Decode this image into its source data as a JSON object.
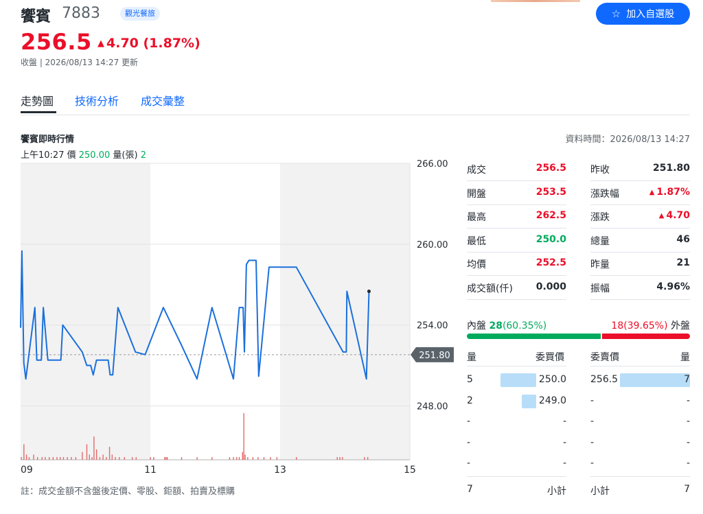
{
  "header": {
    "stock_name": "饗賓",
    "stock_code": "7883",
    "sector_tag": "觀光餐旅",
    "watch_button": "加入自選股",
    "watch_icon": "star-icon",
    "price": "256.5",
    "change": "4.70 (1.87%)",
    "close_time": "收盤 | 2026/08/13 14:27 更新"
  },
  "tabs": [
    {
      "label": "走勢圖",
      "active": true
    },
    {
      "label": "技術分析",
      "active": false
    },
    {
      "label": "成交彙整",
      "active": false
    }
  ],
  "section": {
    "title": "饗賓即時行情",
    "data_time": "資料時間：2026/08/13 14:27",
    "hover_time": "上午10:27",
    "hover_price_label": "價",
    "hover_price": "250.00",
    "hover_vol_label": "量(張)",
    "hover_vol": "2"
  },
  "chart_data": {
    "type": "line",
    "y_ticks": [
      "266.00",
      "260.00",
      "254.00",
      "248.00"
    ],
    "ylim": [
      244.0,
      266.0
    ],
    "x_ticks": [
      "09",
      "11",
      "13",
      "15"
    ],
    "reference_price": "251.80",
    "prev_close_value": 251.8,
    "price_series": [
      [
        9.0,
        253.8
      ],
      [
        9.02,
        259.5
      ],
      [
        9.05,
        251.2
      ],
      [
        9.08,
        250.0
      ],
      [
        9.22,
        255.3
      ],
      [
        9.25,
        251.4
      ],
      [
        9.32,
        251.4
      ],
      [
        9.35,
        255.3
      ],
      [
        9.42,
        251.4
      ],
      [
        9.62,
        251.4
      ],
      [
        9.65,
        254.0
      ],
      [
        9.95,
        252.0
      ],
      [
        10.02,
        251.0
      ],
      [
        10.08,
        251.0
      ],
      [
        10.12,
        250.3
      ],
      [
        10.17,
        251.4
      ],
      [
        10.35,
        251.4
      ],
      [
        10.38,
        250.3
      ],
      [
        10.42,
        250.3
      ],
      [
        10.5,
        255.3
      ],
      [
        10.77,
        252.0
      ],
      [
        10.92,
        251.8
      ],
      [
        11.2,
        255.3
      ],
      [
        11.48,
        252.5
      ],
      [
        11.72,
        250.0
      ],
      [
        11.95,
        255.3
      ],
      [
        12.28,
        250.0
      ],
      [
        12.37,
        255.3
      ],
      [
        12.43,
        255.3
      ],
      [
        12.45,
        252.0
      ],
      [
        12.48,
        258.5
      ],
      [
        12.52,
        258.8
      ],
      [
        12.63,
        258.8
      ],
      [
        12.67,
        250.2
      ],
      [
        12.83,
        258.3
      ],
      [
        13.25,
        258.3
      ],
      [
        13.97,
        252.0
      ],
      [
        14.02,
        252.0
      ],
      [
        14.03,
        256.5
      ],
      [
        14.33,
        250.0
      ],
      [
        14.37,
        256.5
      ]
    ],
    "last_price": 256.5,
    "volume_series": [
      [
        9.01,
        1
      ],
      [
        9.05,
        6
      ],
      [
        9.09,
        2
      ],
      [
        9.13,
        1
      ],
      [
        9.2,
        2
      ],
      [
        9.26,
        1
      ],
      [
        9.33,
        1
      ],
      [
        9.38,
        1
      ],
      [
        9.44,
        1
      ],
      [
        9.5,
        1
      ],
      [
        9.56,
        1
      ],
      [
        9.61,
        1
      ],
      [
        9.66,
        1
      ],
      [
        9.72,
        1
      ],
      [
        9.78,
        1
      ],
      [
        9.85,
        1
      ],
      [
        9.95,
        3
      ],
      [
        10.02,
        6
      ],
      [
        10.06,
        2
      ],
      [
        10.1,
        1
      ],
      [
        10.13,
        9
      ],
      [
        10.17,
        4
      ],
      [
        10.22,
        1
      ],
      [
        10.27,
        2
      ],
      [
        10.32,
        1
      ],
      [
        10.37,
        5
      ],
      [
        10.41,
        2
      ],
      [
        10.46,
        1
      ],
      [
        10.52,
        1
      ],
      [
        10.6,
        1
      ],
      [
        10.72,
        1
      ],
      [
        10.78,
        1
      ],
      [
        11.0,
        1
      ],
      [
        11.05,
        1
      ],
      [
        11.22,
        1
      ],
      [
        11.24,
        1
      ],
      [
        11.26,
        1
      ],
      [
        11.48,
        1
      ],
      [
        11.72,
        1
      ],
      [
        11.95,
        1
      ],
      [
        12.22,
        1
      ],
      [
        12.28,
        1
      ],
      [
        12.33,
        1
      ],
      [
        12.37,
        1
      ],
      [
        12.42,
        3
      ],
      [
        12.44,
        18
      ],
      [
        12.46,
        2
      ],
      [
        12.5,
        1
      ],
      [
        12.58,
        1
      ],
      [
        12.66,
        1
      ],
      [
        12.75,
        1
      ],
      [
        12.85,
        1
      ],
      [
        12.95,
        1
      ],
      [
        13.25,
        1
      ],
      [
        13.88,
        1
      ],
      [
        13.92,
        1
      ],
      [
        13.96,
        1
      ],
      [
        14.3,
        1
      ],
      [
        14.35,
        1
      ]
    ],
    "volume_max": 18,
    "grid": true,
    "shaded_hours": [
      [
        9,
        11
      ],
      [
        13,
        15
      ]
    ]
  },
  "stats": {
    "left": [
      {
        "label": "成交",
        "value": "256.5",
        "color": "red"
      },
      {
        "label": "開盤",
        "value": "253.5",
        "color": "red"
      },
      {
        "label": "最高",
        "value": "262.5",
        "color": "red"
      },
      {
        "label": "最低",
        "value": "250.0",
        "color": "green"
      },
      {
        "label": "均價",
        "value": "252.5",
        "color": "red"
      },
      {
        "label": "成交額(仟)",
        "value": "0.000",
        "color": "dark"
      }
    ],
    "right": [
      {
        "label": "昨收",
        "value": "251.80",
        "color": "dark"
      },
      {
        "label": "漲跌幅",
        "value": "1.87%",
        "color": "red",
        "arrow": true
      },
      {
        "label": "漲跌",
        "value": "4.70",
        "color": "red",
        "arrow": true
      },
      {
        "label": "總量",
        "value": "46",
        "color": "dark"
      },
      {
        "label": "昨量",
        "value": "21",
        "color": "dark"
      },
      {
        "label": "振幅",
        "value": "4.96%",
        "color": "dark"
      }
    ]
  },
  "orderbook": {
    "inner_label": "內盤",
    "inner_value": "28",
    "inner_pct": "(60.35%)",
    "outer_value": "18",
    "outer_pct": "(39.65%)",
    "outer_label": "外盤",
    "inner_ratio": 0.6035,
    "head_qty": "量",
    "head_bid": "委買價",
    "head_ask": "委賣價",
    "head_qty2": "量",
    "rows": [
      {
        "bid_qty": "5",
        "bid": "250.0",
        "ask": "256.5",
        "ask_qty": "7",
        "bid_fill": 0.71,
        "ask_fill": 1.0
      },
      {
        "bid_qty": "2",
        "bid": "249.0",
        "ask": "-",
        "ask_qty": "-",
        "bid_fill": 0.29,
        "ask_fill": 0
      },
      {
        "bid_qty": "-",
        "bid": "-",
        "ask": "-",
        "ask_qty": "-",
        "bid_fill": 0,
        "ask_fill": 0
      },
      {
        "bid_qty": "-",
        "bid": "-",
        "ask": "-",
        "ask_qty": "-",
        "bid_fill": 0,
        "ask_fill": 0
      },
      {
        "bid_qty": "-",
        "bid": "-",
        "ask": "-",
        "ask_qty": "-",
        "bid_fill": 0,
        "ask_fill": 0
      }
    ],
    "bid_total": "7",
    "bid_total_label": "小計",
    "ask_total_label": "小計",
    "ask_total": "7"
  },
  "footnote": "註：成交金額不含盤後定價、零股、鉅額、拍賣及標購",
  "colors": {
    "up": "#eb0f29",
    "down": "#00ab5e",
    "accent": "#0f69ff",
    "line": "#1a6fdc",
    "volume": "#e36a6a"
  }
}
